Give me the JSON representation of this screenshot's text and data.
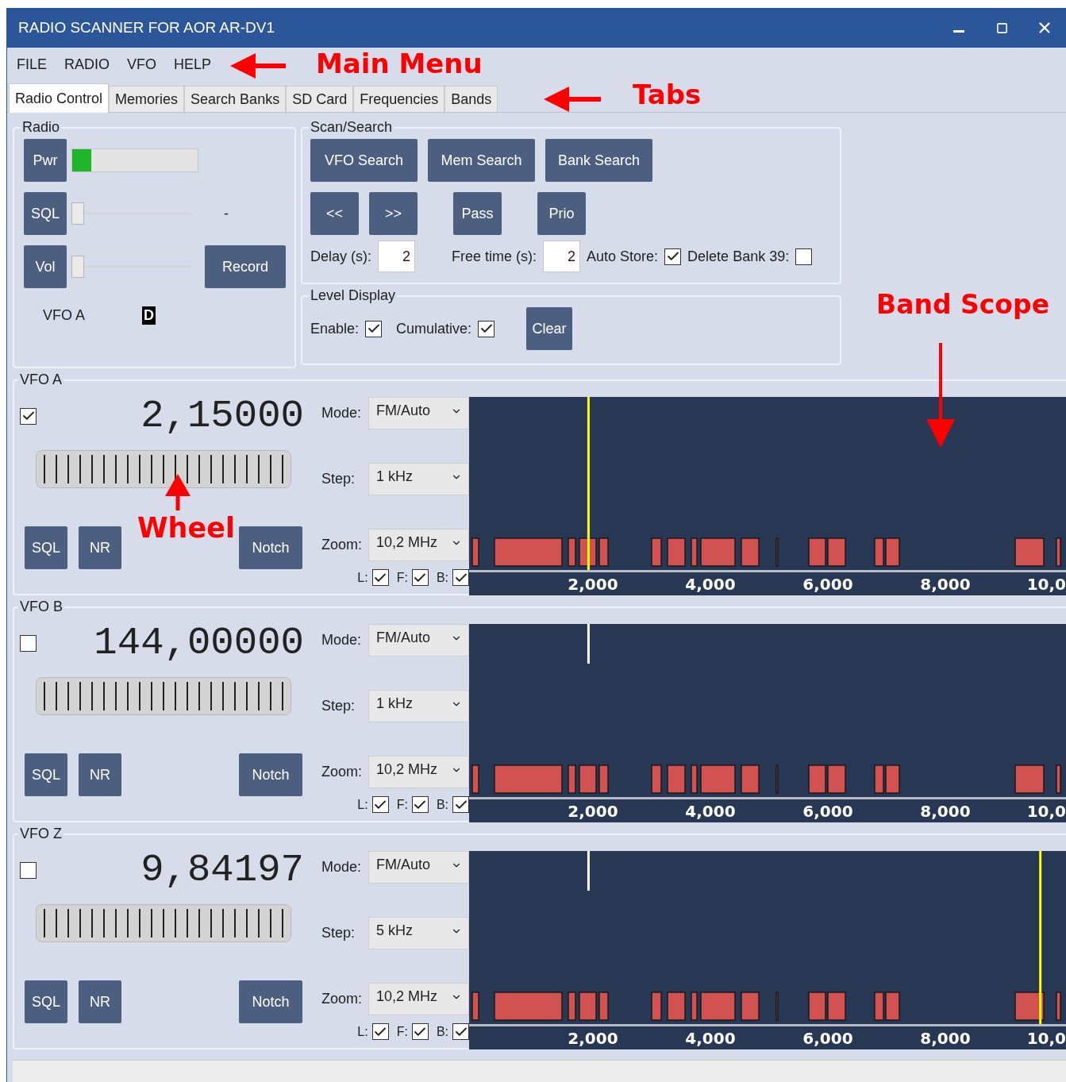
{
  "window": {
    "title": "RADIO SCANNER FOR AOR AR-DV1"
  },
  "menu": [
    {
      "label": "FILE"
    },
    {
      "label": "RADIO"
    },
    {
      "label": "VFO"
    },
    {
      "label": "HELP"
    }
  ],
  "tabs": [
    {
      "label": "Radio Control",
      "selected": true
    },
    {
      "label": "Memories",
      "selected": false
    },
    {
      "label": "Search Banks",
      "selected": false
    },
    {
      "label": "SD Card",
      "selected": false
    },
    {
      "label": "Frequencies",
      "selected": false
    },
    {
      "label": "Bands",
      "selected": false
    }
  ],
  "annotations": [
    {
      "kind": "main_menu",
      "text": "Main Menu"
    },
    {
      "kind": "tabs",
      "text": "Tabs"
    },
    {
      "kind": "band_scope",
      "text": "Band Scope"
    },
    {
      "kind": "wheel",
      "text": "Wheel"
    }
  ],
  "radio": {
    "title": "Radio",
    "pwr": {
      "label": "Pwr",
      "level": 0.15
    },
    "sql": {
      "label": "SQL",
      "level": 0
    },
    "sql_reading": "-",
    "vol": {
      "label": "Vol",
      "level": 0
    },
    "record": "Record",
    "vfo_label": "VFO A",
    "badge": "D"
  },
  "scan": {
    "title": "Scan/Search",
    "search_buttons": [
      "VFO Search",
      "Mem Search",
      "Bank Search"
    ],
    "step_buttons": [
      "<<",
      ">>"
    ],
    "pass": "Pass",
    "prio": "Prio",
    "delay": {
      "label": "Delay (s):",
      "value": "2"
    },
    "free_time": {
      "label": "Free time (s):",
      "value": "2"
    },
    "auto_store": {
      "label": "Auto Store:",
      "checked": true
    },
    "delete_bank": {
      "label": "Delete Bank 39:",
      "checked": false
    }
  },
  "level_display": {
    "title": "Level Display",
    "enable": {
      "label": "Enable:",
      "checked": true
    },
    "cumulative": {
      "label": "Cumulative:",
      "checked": true
    },
    "clear": "Clear"
  },
  "vfos": [
    {
      "title": "VFO A",
      "checked": true,
      "frequency": "2,15000",
      "mode": {
        "label": "Mode:",
        "value": "FM/Auto"
      },
      "step": {
        "label": "Step:",
        "value": "1 kHz"
      },
      "zoom": {
        "label": "Zoom:",
        "value": "10,2 MHz"
      },
      "buttons": [
        "SQL",
        "NR",
        "Notch"
      ],
      "toggles": [
        {
          "label": "L:",
          "checked": true
        },
        {
          "label": "F:",
          "checked": true
        },
        {
          "label": "B:",
          "checked": true
        }
      ],
      "markers": [
        {
          "kind": "tuned",
          "level": 0.2
        }
      ],
      "axis_labels": [
        "2,000",
        "4,000",
        "6,000",
        "8,000",
        "10,0"
      ]
    },
    {
      "title": "VFO B",
      "checked": false,
      "frequency": "144,00000",
      "mode": {
        "label": "Mode:",
        "value": "FM/Auto"
      },
      "step": {
        "label": "Step:",
        "value": "1 kHz"
      },
      "zoom": {
        "label": "Zoom:",
        "value": "10,2 MHz"
      },
      "buttons": [
        "SQL",
        "NR",
        "Notch"
      ],
      "toggles": [
        {
          "label": "L:",
          "checked": true
        },
        {
          "label": "F:",
          "checked": true
        },
        {
          "label": "B:",
          "checked": true
        }
      ],
      "markers": [
        {
          "kind": "signal",
          "level": 0.2
        }
      ],
      "axis_labels": [
        "2,000",
        "4,000",
        "6,000",
        "8,000",
        "10,0"
      ]
    },
    {
      "title": "VFO Z",
      "checked": false,
      "frequency": "9,84197",
      "mode": {
        "label": "Mode:",
        "value": "FM/Auto"
      },
      "step": {
        "label": "Step:",
        "value": "5 kHz"
      },
      "zoom": {
        "label": "Zoom:",
        "value": "10,2 MHz"
      },
      "buttons": [
        "SQL",
        "NR",
        "Notch"
      ],
      "toggles": [
        {
          "label": "L:",
          "checked": true
        },
        {
          "label": "F:",
          "checked": true
        },
        {
          "label": "B:",
          "checked": true
        }
      ],
      "markers": [
        {
          "kind": "signal",
          "level": 0.2
        },
        {
          "kind": "tuned",
          "level": 0.957
        }
      ],
      "axis_labels": [
        "2,000",
        "4,000",
        "6,000",
        "8,000",
        "10,0"
      ]
    }
  ]
}
